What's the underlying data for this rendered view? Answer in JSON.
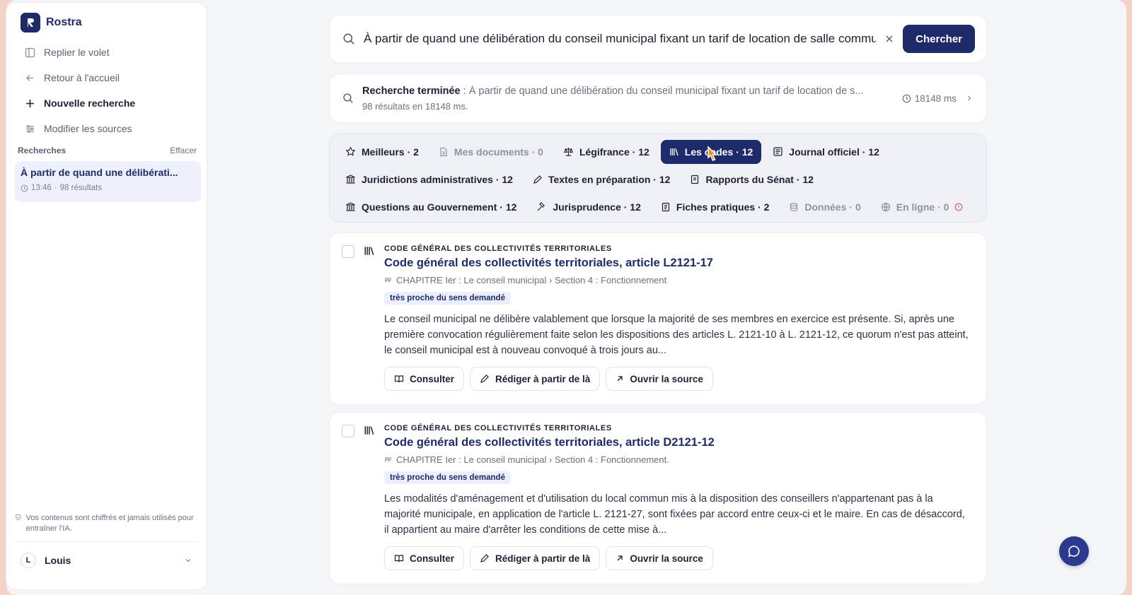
{
  "app": {
    "name": "Rostra"
  },
  "nav": {
    "collapse": "Replier le volet",
    "home": "Retour à l'accueil",
    "new_search": "Nouvelle recherche",
    "sources": "Modifier les sources"
  },
  "history": {
    "heading": "Recherches",
    "clear": "Effacer",
    "item": {
      "title": "À partir de quand une délibérati...",
      "time": "13:46",
      "count": "98 résultats"
    }
  },
  "privacy": "Vos contenus sont chiffrés et jamais utilisés pour entraîner l'IA.",
  "user": {
    "initial": "L",
    "name": "Louis"
  },
  "search": {
    "query": "À partir de quand une délibération du conseil municipal fixant un tarif de location de salle commu",
    "button": "Chercher"
  },
  "status": {
    "label": "Recherche terminée",
    "query": " : À partir de quand une délibération du conseil municipal fixant un tarif de location de s...",
    "detail": "98 résultats en 18148 ms.",
    "time": "18148 ms"
  },
  "tabs": {
    "row1": [
      "Meilleurs · 2",
      "Mes documents · 0",
      "Légifrance · 12",
      "Les codes · 12",
      "Journal officiel · 12"
    ],
    "row2": [
      "Juridictions administratives · 12",
      "Textes en préparation · 12",
      "Rapports du Sénat · 12"
    ],
    "row3": [
      "Questions au Gouvernement · 12",
      "Jurisprudence · 12",
      "Fiches pratiques · 2",
      "Données · 0",
      "En ligne · 0"
    ],
    "active": "Les codes · 12"
  },
  "actions": {
    "consult": "Consulter",
    "draft": "Rédiger à partir de là",
    "open": "Ouvrir la source"
  },
  "results": [
    {
      "source": "CODE GÉNÉRAL DES COLLECTIVITÉS TERRITORIALES",
      "title": "Code général des collectivités territoriales, article L2121-17",
      "path": "CHAPITRE Ier : Le conseil municipal › Section 4 : Fonctionnement",
      "badge": "très proche du sens demandé",
      "text": "Le conseil municipal ne délibère valablement que lorsque la majorité de ses membres en exercice est présente. Si, après une première convocation régulièrement faite selon les dispositions des articles L. 2121-10 à L. 2121-12, ce quorum n'est pas atteint, le conseil municipal est à nouveau convoqué à trois jours au..."
    },
    {
      "source": "CODE GÉNÉRAL DES COLLECTIVITÉS TERRITORIALES",
      "title": "Code général des collectivités territoriales, article D2121-12",
      "path": "CHAPITRE Ier : Le conseil municipal › Section 4 : Fonctionnement.",
      "badge": "très proche du sens demandé",
      "text": "Les modalités d'aménagement et d'utilisation du local commun mis à la disposition des conseillers n'appartenant pas à la majorité municipale, en application de l'article L. 2121-27, sont fixées par accord entre ceux-ci et le maire. En cas de désaccord, il appartient au maire d'arrêter les conditions de cette mise à..."
    }
  ],
  "colors": {
    "accent": "#1f2a6b",
    "badge_bg": "#eceffb",
    "warning": "#e0524f"
  }
}
